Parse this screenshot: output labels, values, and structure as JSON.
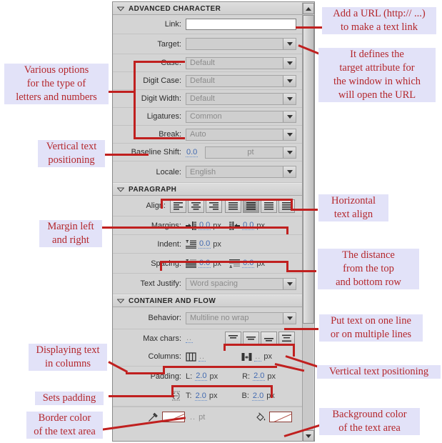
{
  "panel": {
    "sections": [
      {
        "id": "advanced-character",
        "title": "ADVANCED CHARACTER"
      },
      {
        "id": "paragraph",
        "title": "PARAGRAPH"
      },
      {
        "id": "container-and-flow",
        "title": "CONTAINER AND FLOW"
      }
    ],
    "fields": {
      "link": {
        "label": "Link:",
        "value": "",
        "placeholder": ""
      },
      "target": {
        "label": "Target:",
        "value": "",
        "disabled": true
      },
      "case": {
        "label": "Case:",
        "value": "Default"
      },
      "digit_case": {
        "label": "Digit Case:",
        "value": "Default"
      },
      "digit_width": {
        "label": "Digit Width:",
        "value": "Default"
      },
      "ligatures": {
        "label": "Ligatures:",
        "value": "Common"
      },
      "break": {
        "label": "Break:",
        "value": "Auto"
      },
      "baseline_shift": {
        "label": "Baseline Shift:",
        "value": "0.0",
        "unit_value": "pt"
      },
      "locale": {
        "label": "Locale:",
        "value": "English"
      },
      "align": {
        "label": "Align:"
      },
      "margins": {
        "label": "Margins:",
        "left_value": "0.0",
        "left_unit": "px",
        "right_value": "0.0",
        "right_unit": "px"
      },
      "indent": {
        "label": "Indent:",
        "value": "0.0",
        "unit": "px"
      },
      "spacing": {
        "label": "Spacing:",
        "top_value": "0.0",
        "top_unit": "px",
        "bottom_value": "0.0",
        "bottom_unit": "px"
      },
      "text_justify": {
        "label": "Text Justify:",
        "value": "Word spacing"
      },
      "behavior": {
        "label": "Behavior:",
        "value": "Multiline no wrap"
      },
      "max_chars": {
        "label": "Max chars:",
        "value": ".."
      },
      "columns": {
        "label": "Columns:",
        "count_value": "..",
        "gutter_value": "..",
        "gutter_unit": "px"
      },
      "padding": {
        "label": "Padding:",
        "l_prefix": "L:",
        "l_value": "2.0",
        "l_unit": "px",
        "r_prefix": "R:",
        "r_value": "2.0",
        "r_unit": "px",
        "t_prefix": "T:",
        "t_value": "2.0",
        "t_unit": "px",
        "b_prefix": "B:",
        "b_value": "2.0",
        "b_unit": "px"
      },
      "border": {
        "stroke_value": "..",
        "stroke_unit": "pt"
      }
    },
    "align_buttons": [
      {
        "name": "align-left",
        "selected": false
      },
      {
        "name": "align-center",
        "selected": false
      },
      {
        "name": "align-right",
        "selected": false
      },
      {
        "name": "justify-left",
        "selected": false
      },
      {
        "name": "justify-center",
        "selected": true
      },
      {
        "name": "justify-right",
        "selected": false
      },
      {
        "name": "justify-full",
        "selected": false
      }
    ],
    "vertical_align_buttons": [
      {
        "name": "valign-top",
        "selected": false
      },
      {
        "name": "valign-middle",
        "selected": false
      },
      {
        "name": "valign-bottom",
        "selected": false
      },
      {
        "name": "valign-justify",
        "selected": false
      }
    ]
  },
  "annotations": {
    "add_url": "Add a URL (http:// ...)\nto make a text link",
    "target_attribute": "It defines the\ntarget attribute for\nthe window in which\nwill open the URL",
    "various_options": "Various options\nfor the type of\nletters and numbers",
    "vertical_text_positioning_left": "Vertical text\npositioning",
    "horizontal_text_align": "Horizontal\ntext align",
    "margin_left_right": "Margin left\nand right",
    "distance_top_bottom": "The distance\nfrom the top\nand bottom row",
    "put_text_lines": "Put text on one line\nor on multiple lines",
    "displaying_columns": "Displaying text\nin columns",
    "vertical_text_positioning_right": "Vertical text positioning",
    "sets_padding": "Sets padding",
    "border_color": "Border color\nof the text area",
    "background_color": "Background color\nof the text area"
  },
  "colors": {
    "annotation_text": "#b4272c",
    "annotation_bg": "#e2e2f8",
    "connector_line": "#c0201f",
    "panel_bg": "#d4d4d4",
    "value_blue": "#4169b0"
  }
}
